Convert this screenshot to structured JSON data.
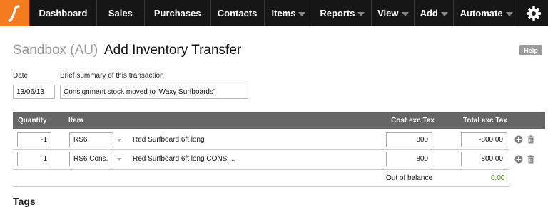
{
  "nav": {
    "items": [
      {
        "label": "Dashboard",
        "has_menu": false
      },
      {
        "label": "Sales",
        "has_menu": false
      },
      {
        "label": "Purchases",
        "has_menu": false
      },
      {
        "label": "Contacts",
        "has_menu": false
      },
      {
        "label": "Items",
        "has_menu": true
      },
      {
        "label": "Reports",
        "has_menu": true
      },
      {
        "label": "View",
        "has_menu": true
      },
      {
        "label": "Add",
        "has_menu": true
      },
      {
        "label": "Automate",
        "has_menu": true
      }
    ],
    "logo_icon": "logo-icon",
    "settings_icon": "gear-icon",
    "accent_color": "#f47b20"
  },
  "page": {
    "organisation": "Sandbox (AU)",
    "title": "Add Inventory Transfer",
    "help_label": "Help"
  },
  "form": {
    "date_label": "Date",
    "date_value": "13/06/13",
    "summary_label": "Brief summary of this transaction",
    "summary_value": "Consignment stock moved to 'Waxy Surfboards'"
  },
  "table": {
    "headers": {
      "quantity": "Quantity",
      "item": "Item",
      "cost": "Cost exc Tax",
      "total": "Total exc Tax"
    },
    "rows": [
      {
        "quantity": "-1",
        "item_code": "RS6",
        "description": "Red Surfboard 6ft long",
        "cost": "800",
        "total": "-800.00"
      },
      {
        "quantity": "1",
        "item_code": "RS6 Cons.",
        "description": "Red Surfboard 6ft long CONS ...",
        "cost": "800",
        "total": "800.00"
      }
    ],
    "out_of_balance_label": "Out of balance",
    "out_of_balance_value": "0.00",
    "balance_color": "#3a8a20"
  },
  "tags_heading": "Tags"
}
